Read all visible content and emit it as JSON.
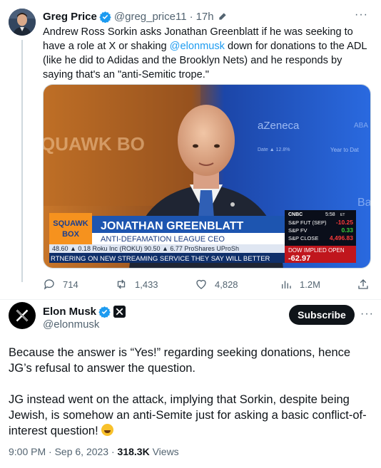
{
  "quoted_tweet": {
    "name": "Greg Price",
    "handle": "@greg_price11",
    "separator": "·",
    "time": "17h",
    "more": "···",
    "text_before": "Andrew Ross Sorkin asks Jonathan Greenblatt if he was seeking to have a role at X or shaking ",
    "mention": "@elonmusk",
    "text_after": " down for donations to the ADL (like he did to Adidas and the Brooklyn Nets) and he responds by saying that's an \"anti-Semitic trope.\"",
    "media": {
      "bg_text_squawk": "QUAWK BO",
      "bg_text_zeneca": "aZeneca",
      "bg_text_date": "Date ▲ 12.8%",
      "bg_text_year": "Year to Dat",
      "bg_text_bai": "Bai",
      "bg_text_aba": "ABA",
      "show_logo_line1": "SQUAWK",
      "show_logo_line2": "BOX",
      "guest_name": "JONATHAN GREENBLATT",
      "guest_title": "ANTI-DEFAMATION LEAGUE CEO",
      "ticker_top": "48.60 ▲ 0.18   Roku Inc (ROKU) 90.50 ▲ 6.77   ProShares UProSh",
      "ticker_bottom": "RTNERING ON NEW STREAMING SERVICE THEY SAY WILL BETTER",
      "cnbc_label": "CNBC",
      "cnbc_time": "5:58",
      "cnbc_time_suffix": "ET",
      "market": [
        {
          "label": "S&P FUT (SEP)",
          "value": "-10.25",
          "color": "#ff3b3b"
        },
        {
          "label": "S&P FV",
          "value": "0.33",
          "color": "#3bd13b"
        },
        {
          "label": "S&P CLOSE",
          "value": "4,496.83",
          "color": "#ff3b3b"
        }
      ],
      "dow_label": "DOW IMPLIED OPEN",
      "dow_value": "-62.97"
    },
    "actions": {
      "replies": "714",
      "reposts": "1,433",
      "likes": "4,828",
      "views": "1.2M"
    }
  },
  "main_tweet": {
    "name": "Elon Musk",
    "handle": "@elonmusk",
    "subscribe_label": "Subscribe",
    "more": "···",
    "paragraph1": "Because the answer is “Yes!” regarding seeking donations, hence JG’s refusal to answer the question.",
    "paragraph2": "JG instead went on the attack, implying that Sorkin, despite being Jewish, is somehow an anti-Semite just for asking a basic conflict-of-interest question! ",
    "emoji_name": "rolling-on-floor-laughing",
    "timestamp": "9:00 PM · Sep 6, 2023",
    "meta_separator": " · ",
    "views_count": "318.3K",
    "views_label": " Views"
  },
  "colors": {
    "link": "#1d9bf0",
    "verified": "#1d9bf0",
    "text": "#0f1419",
    "muted": "#536471",
    "lower_third_blue": "#1d55b0",
    "show_logo_orange": "#f6921e"
  }
}
